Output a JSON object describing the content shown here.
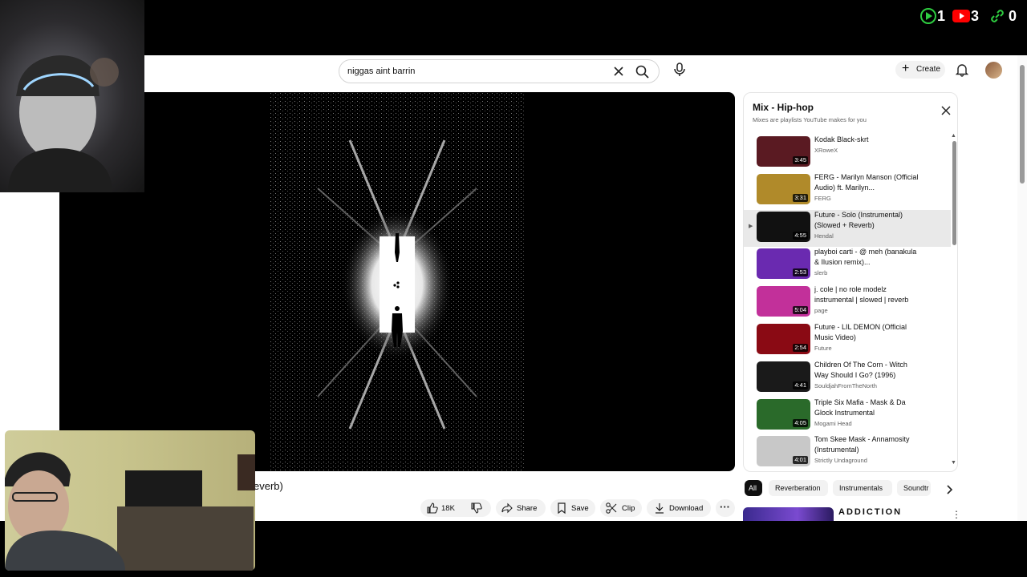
{
  "search": {
    "query": "niggas aint barrin"
  },
  "header": {
    "create_label": "Create"
  },
  "video": {
    "title_fragment": "everb)",
    "actions": {
      "likes": "18K",
      "share": "Share",
      "save": "Save",
      "clip": "Clip",
      "download": "Download"
    }
  },
  "playlist": {
    "title": "Mix - Hip-hop",
    "subtitle": "Mixes are playlists YouTube makes for you",
    "items": [
      {
        "title": "Kodak Black-skrt",
        "channel": "XRoweX",
        "duration": "3:45",
        "thumb_color": "#5a1a22"
      },
      {
        "title": "FERG - Marilyn Manson (Official Audio) ft. Marilyn...",
        "channel": "FERG",
        "duration": "3:31",
        "thumb_color": "#b08a2a"
      },
      {
        "title": "Future - Solo (Instrumental) (Slowed + Reverb)",
        "channel": "Hendal",
        "duration": "4:55",
        "thumb_color": "#111111",
        "active": true
      },
      {
        "title": "playboi carti - @ meh (banakula & Ilusion remix)...",
        "channel": "slerb",
        "duration": "2:53",
        "thumb_color": "#6a2ab0"
      },
      {
        "title": "j. cole | no role modelz instrumental | slowed | reverb",
        "channel": "page",
        "duration": "5:04",
        "thumb_color": "#c2309a"
      },
      {
        "title": "Future - LIL DEMON (Official Music Video)",
        "channel": "Future",
        "duration": "2:54",
        "thumb_color": "#8a0a14"
      },
      {
        "title": "Children Of The Corn - Witch Way Should I Go? (1996)",
        "channel": "SouldjahFromTheNorth",
        "duration": "4:41",
        "thumb_color": "#1a1a1a"
      },
      {
        "title": "Triple Six Mafia - Mask & Da Glock Instrumental",
        "channel": "Mogami Head",
        "duration": "4:05",
        "thumb_color": "#2a6a2a"
      },
      {
        "title": "Tom Skee Mask - Annamosity (Instrumental)",
        "channel": "Strictly Undaground",
        "duration": "4:01",
        "thumb_color": "#c8c8c8"
      }
    ]
  },
  "chips": [
    "All",
    "Reverberation",
    "Instrumentals",
    "Soundtr"
  ],
  "recommendation": {
    "title": "ADDICTION"
  },
  "counters": {
    "play_count": "1",
    "youtube_count": "3",
    "link_count": "0"
  }
}
